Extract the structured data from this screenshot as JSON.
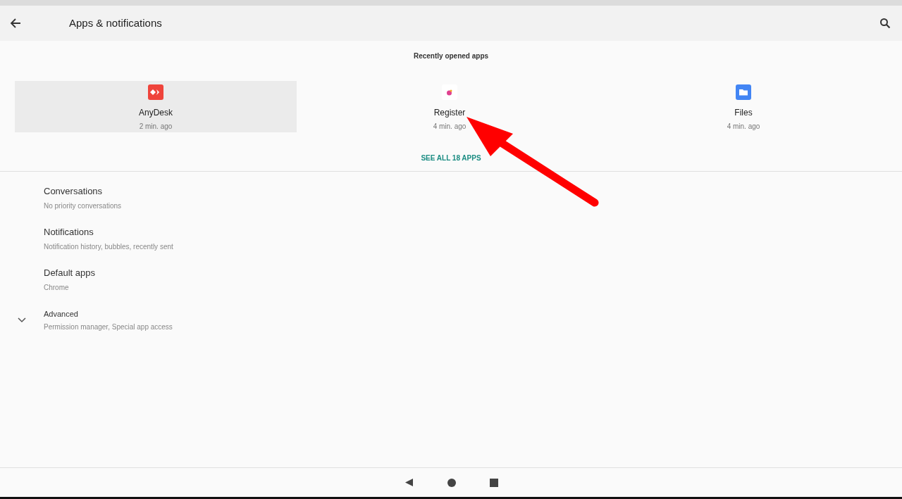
{
  "header": {
    "title": "Apps & notifications"
  },
  "recent_apps": {
    "title": "Recently opened apps",
    "apps": [
      {
        "name": "AnyDesk",
        "time": "2 min. ago",
        "selected": true,
        "kind": "anydesk"
      },
      {
        "name": "Register",
        "time": "4 min. ago",
        "selected": false,
        "kind": "register"
      },
      {
        "name": "Files",
        "time": "4 min. ago",
        "selected": false,
        "kind": "files"
      }
    ],
    "see_all": "SEE ALL 18 APPS"
  },
  "settings": [
    {
      "kind": "plain",
      "title": "Conversations",
      "summary": "No priority conversations"
    },
    {
      "kind": "plain",
      "title": "Notifications",
      "summary": "Notification history, bubbles, recently sent"
    },
    {
      "kind": "plain",
      "title": "Default apps",
      "summary": "Chrome"
    },
    {
      "kind": "expandable",
      "title": "Advanced",
      "summary": "Permission manager, Special app access"
    }
  ]
}
